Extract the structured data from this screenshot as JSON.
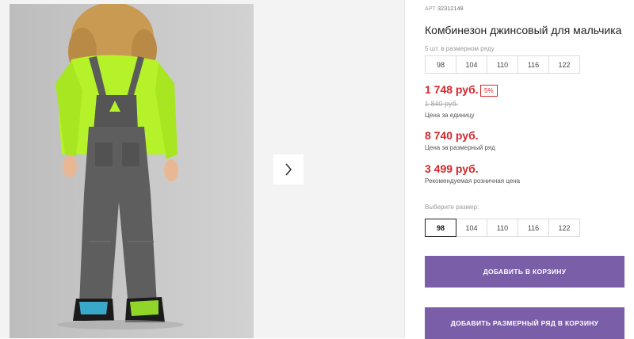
{
  "product": {
    "art_label": "АРТ",
    "art_number": "32312148",
    "title": "Комбинезон джинсовый для мальчика",
    "pack_label": "5 шт. в размерном ряду",
    "pack_sizes": [
      "98",
      "104",
      "110",
      "116",
      "122"
    ],
    "price": "1 748 руб.",
    "discount": "5%",
    "old_price": "1 840 руб.",
    "price_caption": "Цена за единицу",
    "pack_price": "8 740 руб.",
    "pack_price_caption": "Цена за размерный ряд",
    "retail_price": "3 499 руб.",
    "retail_price_caption": "Рекомендуемая розничная цена",
    "choose_size_label": "Выберите размер:",
    "sizes": [
      "98",
      "104",
      "110",
      "116",
      "122"
    ],
    "selected_size": "98",
    "add_to_cart": "ДОБАВИТЬ В КОРЗИНУ",
    "add_pack_to_cart": "ДОБАВИТЬ РАЗМЕРНЫЙ РЯД В КОРЗИНУ"
  },
  "gallery": {
    "next_icon": "chevron-right-icon"
  },
  "colors": {
    "price_red": "#d4262b",
    "button_purple": "#7a5fa8",
    "shirt_green": "#b5f22a"
  }
}
